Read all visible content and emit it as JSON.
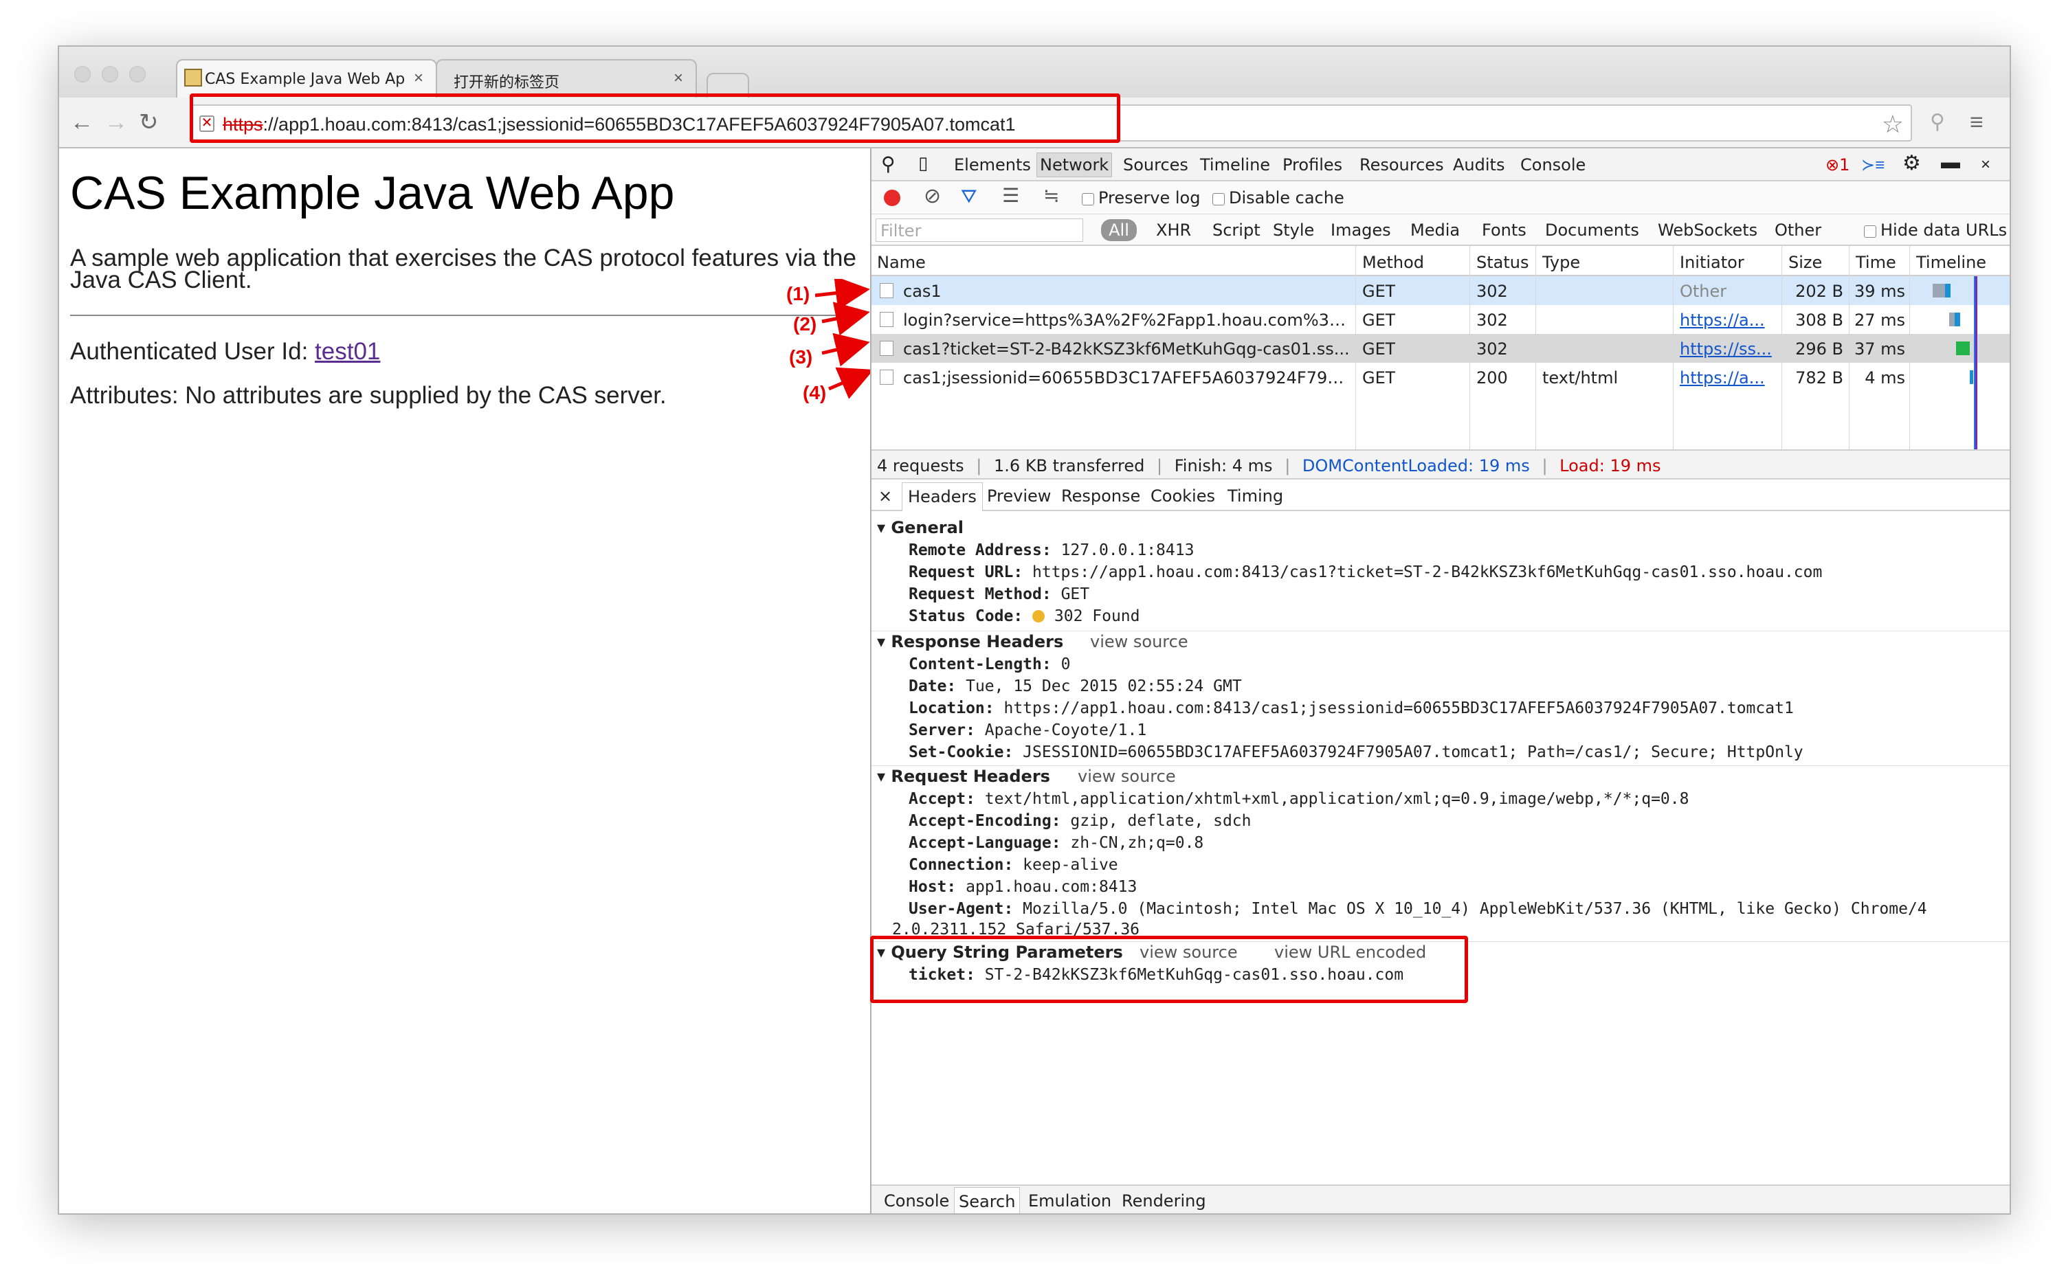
{
  "tabs": [
    {
      "title": "CAS Example Java Web Ap",
      "close": "×"
    },
    {
      "title": "打开新的标签页",
      "close": "×"
    }
  ],
  "address": {
    "scheme": "https",
    "rest": "://app1.hoau.com:8413/cas1;jsessionid=60655BD3C17AFEF5A6037924F7905A07.tomcat1"
  },
  "page": {
    "title": "CAS Example Java Web App",
    "description": "A sample web application that exercises the CAS protocol features via the Java CAS Client.",
    "user_label": "Authenticated User Id: ",
    "user_id": "test01",
    "attributes": "Attributes: No attributes are supplied by the CAS server."
  },
  "callouts": [
    "(1)",
    "(2)",
    "(3)",
    "(4)"
  ],
  "devtools": {
    "tabs": [
      "Elements",
      "Network",
      "Sources",
      "Timeline",
      "Profiles",
      "Resources",
      "Audits",
      "Console"
    ],
    "error_count": "1",
    "preserve_log": "Preserve log",
    "disable_cache": "Disable cache",
    "filter_placeholder": "Filter",
    "filter_types": [
      "All",
      "XHR",
      "Script",
      "Style",
      "Images",
      "Media",
      "Fonts",
      "Documents",
      "WebSockets",
      "Other"
    ],
    "hide_data_urls": "Hide data URLs",
    "columns": [
      "Name",
      "Method",
      "Status",
      "Type",
      "Initiator",
      "Size",
      "Time",
      "Timeline"
    ],
    "requests": [
      {
        "name": "cas1",
        "method": "GET",
        "status": "302",
        "type": "",
        "initiator": "Other",
        "size": "202 B",
        "time": "39 ms"
      },
      {
        "name": "login?service=https%3A%2F%2Fapp1.hoau.com%3A84...",
        "method": "GET",
        "status": "302",
        "type": "",
        "initiator": "https://a...",
        "size": "308 B",
        "time": "27 ms"
      },
      {
        "name": "cas1?ticket=ST-2-B42kKSZ3kf6MetKuhGqg-cas01.ss...",
        "method": "GET",
        "status": "302",
        "type": "",
        "initiator": "https://ss...",
        "size": "296 B",
        "time": "37 ms"
      },
      {
        "name": "cas1;jsessionid=60655BD3C17AFEF5A6037924F790...",
        "method": "GET",
        "status": "200",
        "type": "text/html",
        "initiator": "https://a...",
        "size": "782 B",
        "time": "4 ms"
      }
    ],
    "summary": {
      "requests": "4 requests",
      "transferred": "1.6 KB transferred",
      "finish": "Finish: 4 ms",
      "dcl": "DOMContentLoaded: 19 ms",
      "load": "Load: 19 ms",
      "sep": "|"
    },
    "detail_tabs": [
      "Headers",
      "Preview",
      "Response",
      "Cookies",
      "Timing"
    ],
    "close": "×",
    "general": {
      "title": "General",
      "items": [
        {
          "k": "Remote Address:",
          "v": " 127.0.0.1:8413"
        },
        {
          "k": "Request URL:",
          "v": " https://app1.hoau.com:8413/cas1?ticket=ST-2-B42kKSZ3kf6MetKuhGqg-cas01.sso.hoau.com"
        },
        {
          "k": "Request Method:",
          "v": " GET"
        },
        {
          "k": "Status Code:",
          "v": " 302 Found"
        }
      ]
    },
    "response_headers": {
      "title": "Response Headers",
      "view_source": "view source",
      "items": [
        {
          "k": "Content-Length:",
          "v": " 0"
        },
        {
          "k": "Date:",
          "v": " Tue, 15 Dec 2015 02:55:24 GMT"
        },
        {
          "k": "Location:",
          "v": " https://app1.hoau.com:8413/cas1;jsessionid=60655BD3C17AFEF5A6037924F7905A07.tomcat1"
        },
        {
          "k": "Server:",
          "v": " Apache-Coyote/1.1"
        },
        {
          "k": "Set-Cookie:",
          "v": " JSESSIONID=60655BD3C17AFEF5A6037924F7905A07.tomcat1; Path=/cas1/; Secure; HttpOnly"
        }
      ]
    },
    "request_headers": {
      "title": "Request Headers",
      "view_source": "view source",
      "items": [
        {
          "k": "Accept:",
          "v": " text/html,application/xhtml+xml,application/xml;q=0.9,image/webp,*/*;q=0.8"
        },
        {
          "k": "Accept-Encoding:",
          "v": " gzip, deflate, sdch"
        },
        {
          "k": "Accept-Language:",
          "v": " zh-CN,zh;q=0.8"
        },
        {
          "k": "Connection:",
          "v": " keep-alive"
        },
        {
          "k": "Host:",
          "v": " app1.hoau.com:8413"
        },
        {
          "k": "User-Agent:",
          "v": " Mozilla/5.0 (Macintosh; Intel Mac OS X 10_10_4) AppleWebKit/537.36 (KHTML, like Gecko) Chrome/4"
        }
      ],
      "ua_cont": "2.0.2311.152 Safari/537.36"
    },
    "query": {
      "title": "Query String Parameters",
      "view_source": "view source",
      "view_url_encoded": "view URL encoded",
      "items": [
        {
          "k": "ticket:",
          "v": " ST-2-B42kKSZ3kf6MetKuhGqg-cas01.sso.hoau.com"
        }
      ]
    },
    "drawer_tabs": [
      "Console",
      "Search",
      "Emulation",
      "Rendering"
    ]
  },
  "colors": {
    "highlight": "#e60000",
    "selected_row": "#d5e8fb",
    "hover_row": "#d8d8d8",
    "status_dot": "#f0b429",
    "dcl": "#1155cc",
    "load": "#d10000"
  }
}
